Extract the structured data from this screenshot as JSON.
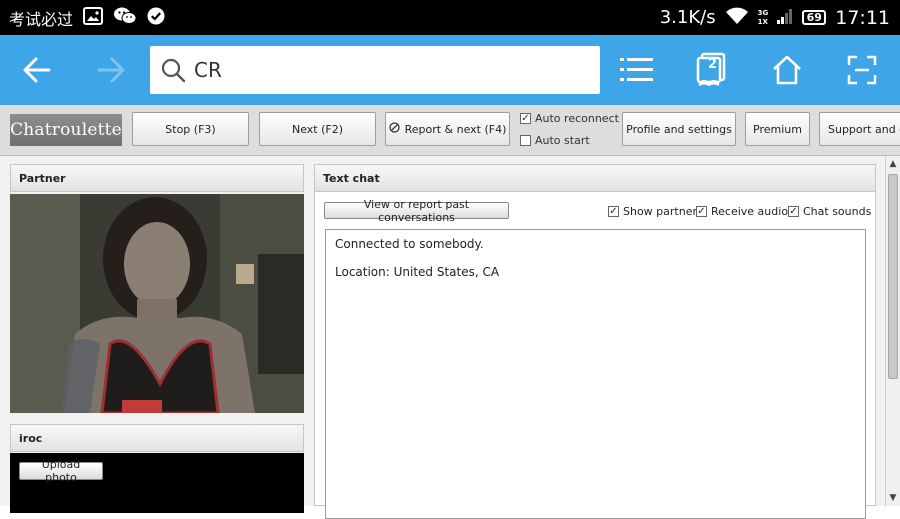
{
  "status_bar": {
    "app_title": "考试必过",
    "net_speed": "3.1K/s",
    "network_top": "3G",
    "network_bottom": "1X",
    "battery": "69",
    "time": "17:11",
    "icons": [
      "image-icon",
      "wechat-icon",
      "check-circle-icon",
      "wifi-icon",
      "signal-icon",
      "battery-icon"
    ]
  },
  "browser": {
    "address_text": "CR",
    "tab_count": "2",
    "icons": [
      "back-icon",
      "forward-icon",
      "search-icon",
      "menu-icon",
      "tabs-icon",
      "home-icon",
      "fullscreen-icon"
    ]
  },
  "chatroulette": {
    "logo": "Chatroulette",
    "buttons": {
      "stop": "Stop (F3)",
      "next": "Next (F2)",
      "report_next": "Report & next (F4)",
      "profile": "Profile and settings",
      "premium": "Premium",
      "support": "Support and co"
    },
    "checkboxes": {
      "auto_reconnect": "Auto reconnect",
      "auto_reconnect_checked": true,
      "auto_start": "Auto start",
      "auto_start_checked": false
    }
  },
  "partner_panel": {
    "title": "Partner"
  },
  "self_panel": {
    "title": "iroc",
    "upload_label": "Upload photo"
  },
  "text_chat": {
    "title": "Text chat",
    "past_conversations_label": "View or report past conversations",
    "options": {
      "show_partner": "Show partner",
      "receive_audio": "Receive audio",
      "chat_sounds": "Chat sounds"
    },
    "messages": [
      "Connected to somebody.",
      "Location: United States, CA"
    ]
  },
  "colors": {
    "toolbar": "#3ea5e8",
    "statusbar": "#000000",
    "nav_bg": "#dddddd",
    "logo_bg": "#7c7c7c"
  }
}
